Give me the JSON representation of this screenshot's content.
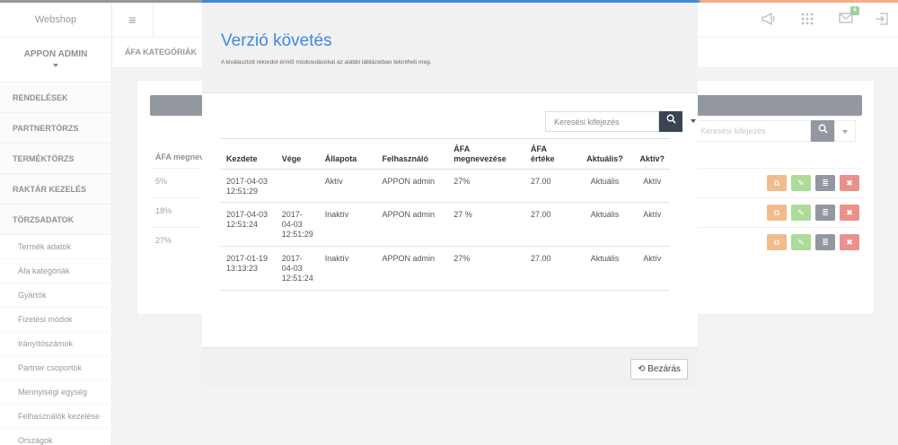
{
  "app": {
    "brand": "Webshop",
    "user": "APPON ADMIN"
  },
  "header": {
    "menu_glyph": "≡",
    "icons": [
      "megaphone-icon",
      "grid-icon",
      "mail-icon",
      "logout-icon"
    ],
    "mail_badge": "4"
  },
  "sidebar": {
    "sections": [
      {
        "label": "RENDELÉSEK"
      },
      {
        "label": "PARTNERTÖRZS"
      },
      {
        "label": "TERMÉKTÖRZS"
      },
      {
        "label": "RAKTÁR KEZELÉS"
      },
      {
        "label": "TÖRZSADATOK"
      }
    ],
    "subitems": [
      {
        "label": "Termék adatok"
      },
      {
        "label": "Áfa kategóriák"
      },
      {
        "label": "Gyártók"
      },
      {
        "label": "Fizetési módok"
      },
      {
        "label": "Irányítószámok"
      },
      {
        "label": "Partner csoportok"
      },
      {
        "label": "Mennyiségi egység"
      },
      {
        "label": "Felhasználók kezelése"
      },
      {
        "label": "Országok"
      }
    ]
  },
  "breadcrumb": "ÁFA KATEGÓRIÁK",
  "background": {
    "search_placeholder": "Keresési kifejezés",
    "column_header": "ÁFA megnev",
    "rows": [
      {
        "value": "5%"
      },
      {
        "value": "18%"
      },
      {
        "value": "27%"
      }
    ]
  },
  "modal": {
    "title": "Verzió követés",
    "subtitle": "A kiválasztott rekordot érintő módosulásokat az alábbi táblázatban tekintheti meg.",
    "search_placeholder": "Keresési kifejezés",
    "columns": [
      "Kezdete",
      "Vége",
      "Állapota",
      "Felhasználó",
      "ÁFA megnevezése",
      "ÁFA értéke",
      "Aktuális?",
      "Aktív?"
    ],
    "rows": [
      {
        "start": "2017-04-03 12:51:29",
        "end": "",
        "state": "Aktív",
        "user": "APPON admin",
        "name": "27%",
        "value": "27.00",
        "current": "Aktuális",
        "active": "Aktív"
      },
      {
        "start": "2017-04-03 12:51:24",
        "end": "2017-04-03 12:51:29",
        "state": "Inaktív",
        "user": "APPON admin",
        "name": "27 %",
        "value": "27.00",
        "current": "Aktuális",
        "active": "Aktív"
      },
      {
        "start": "2017-01-19 13:13:23",
        "end": "2017-04-03 12:51:24",
        "state": "Inaktív",
        "user": "APPON admin",
        "name": "27%",
        "value": "27.00",
        "current": "Aktuális",
        "active": "Aktív"
      }
    ],
    "close_label": "Bezárás"
  },
  "colors": {
    "accent": "#3c8bd9",
    "dark": "#3b4452",
    "orange": "#e8832f",
    "green": "#6abe45",
    "red": "#d63a2d"
  }
}
